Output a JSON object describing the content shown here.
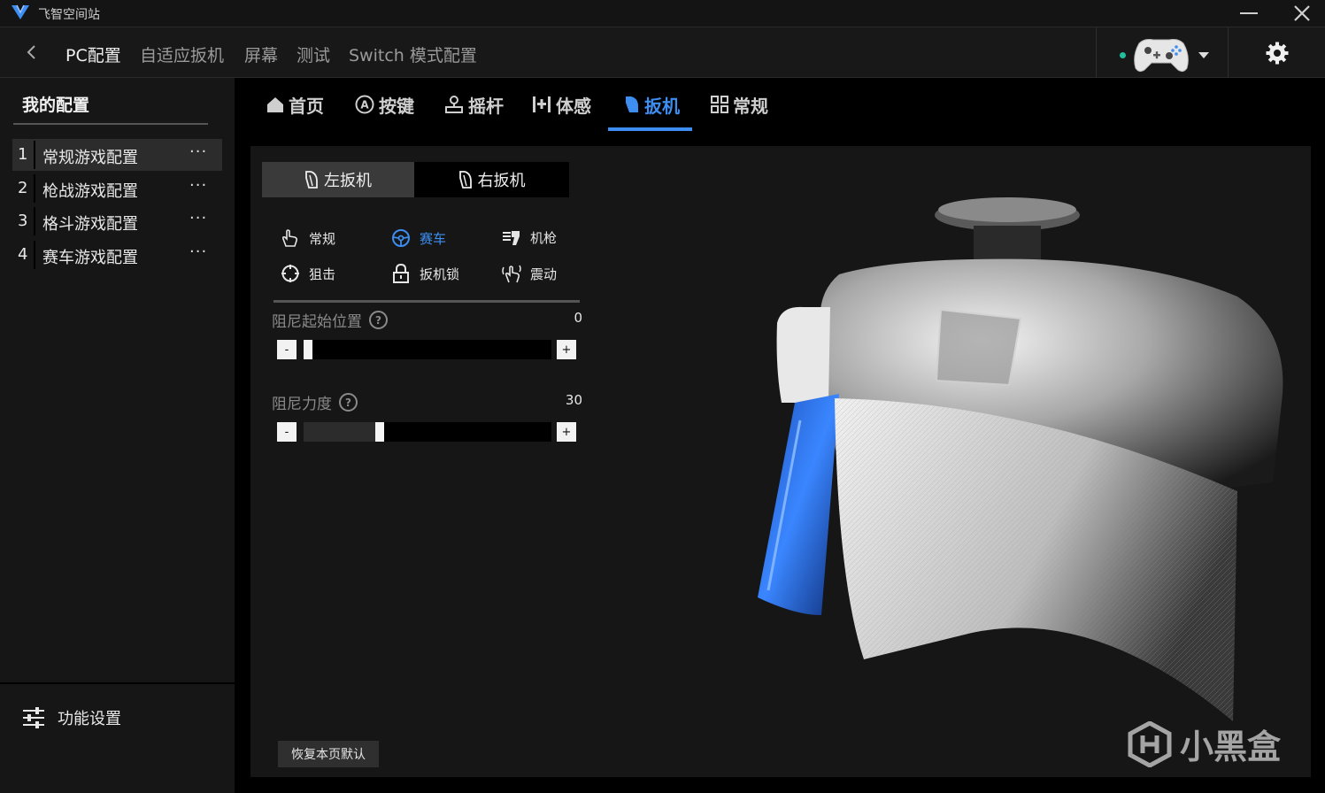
{
  "window": {
    "title": "飞智空间站"
  },
  "topnav": {
    "items": [
      "PC配置",
      "自适应扳机",
      "屏幕",
      "测试",
      "Switch 模式配置"
    ]
  },
  "sidebar": {
    "heading": "我的配置",
    "profiles": [
      {
        "num": "1",
        "name": "常规游戏配置",
        "more": "···"
      },
      {
        "num": "2",
        "name": "枪战游戏配置",
        "more": "···"
      },
      {
        "num": "3",
        "name": "格斗游戏配置",
        "more": "···"
      },
      {
        "num": "4",
        "name": "赛车游戏配置",
        "more": "···"
      }
    ],
    "footer_label": "功能设置"
  },
  "tabs": [
    "首页",
    "按键",
    "摇杆",
    "体感",
    "扳机",
    "常规"
  ],
  "trigger_side": {
    "left": "左扳机",
    "right": "右扳机"
  },
  "modes": [
    "常规",
    "赛车",
    "机枪",
    "狙击",
    "扳机锁",
    "震动"
  ],
  "sliders": [
    {
      "label": "阻尼起始位置",
      "value": "0",
      "minus": "-",
      "plus": "+"
    },
    {
      "label": "阻尼力度",
      "value": "30",
      "minus": "-",
      "plus": "+"
    }
  ],
  "reset_label": "恢复本页默认",
  "watermark": "小黑盒",
  "colors": {
    "accent": "#3d8ef0",
    "status_dot": "#1fbf9f"
  }
}
